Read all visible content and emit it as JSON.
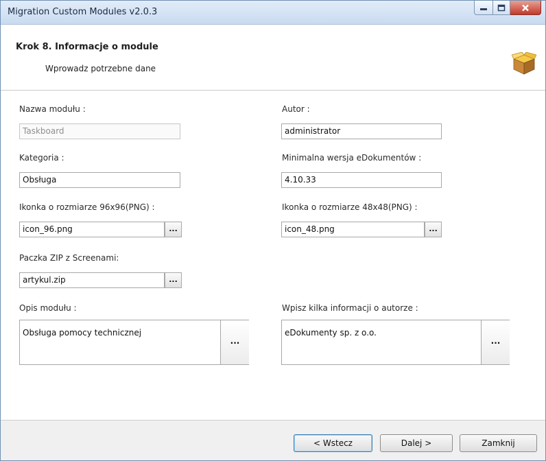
{
  "window": {
    "title": "Migration Custom Modules v2.0.3"
  },
  "header": {
    "step_title": "Krok 8. Informacje o module",
    "subtitle": "Wprowadz potrzebne dane",
    "icon": "package-box-icon"
  },
  "form": {
    "module_name": {
      "label": "Nazwa modułu :",
      "value": "Taskboard",
      "enabled": false
    },
    "author": {
      "label": "Autor :",
      "value": "administrator"
    },
    "category": {
      "label": "Kategoria :",
      "value": "Obsługa"
    },
    "min_version": {
      "label": "Minimalna wersja eDokumentów :",
      "value": "4.10.33"
    },
    "icon96": {
      "label": "Ikonka o rozmiarze 96x96(PNG) :",
      "value": "icon_96.png",
      "browse": "..."
    },
    "icon48": {
      "label": "Ikonka o rozmiarze 48x48(PNG) :",
      "value": "icon_48.png",
      "browse": "..."
    },
    "zip": {
      "label": "Paczka ZIP z Screenami:",
      "value": "artykul.zip",
      "browse": "..."
    },
    "description": {
      "label": "Opis modułu :",
      "value": "Obsługa pomocy technicznej",
      "edit": "..."
    },
    "author_info": {
      "label": "Wpisz kilka informacji o autorze :",
      "value": "eDokumenty sp. z o.o.",
      "edit": "..."
    }
  },
  "footer": {
    "back": "< Wstecz",
    "next": "Dalej >",
    "close": "Zamknij"
  },
  "colors": {
    "titlebar": "#c9dbf1",
    "close_button": "#c0392b",
    "default_button_border": "#3c7fb1"
  }
}
